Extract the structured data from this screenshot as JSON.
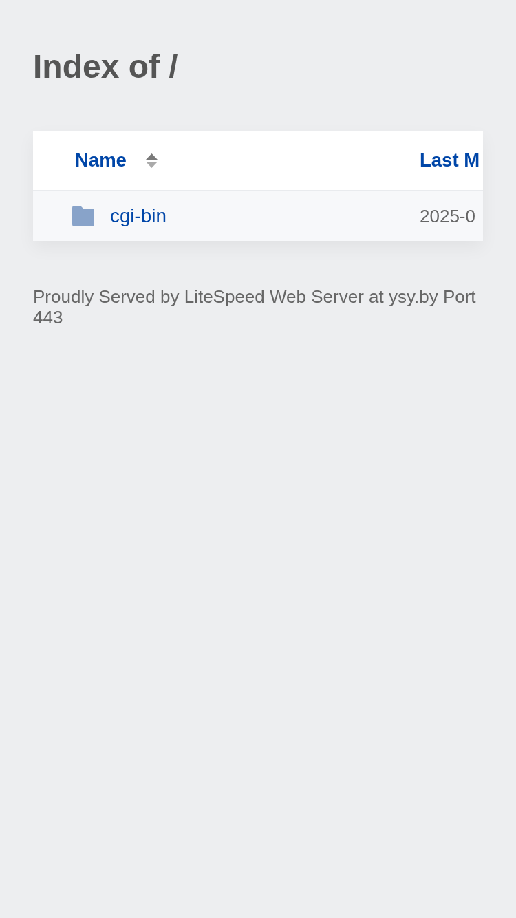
{
  "title": "Index of /",
  "table": {
    "columns": [
      {
        "label": "Name",
        "sortable": true
      },
      {
        "label": "Last M"
      }
    ],
    "rows": [
      {
        "kind": "folder",
        "name": "cgi-bin",
        "column_2": "2025-0"
      }
    ]
  },
  "footer": "Proudly Served by LiteSpeed Web Server at ysy.by Port 443"
}
